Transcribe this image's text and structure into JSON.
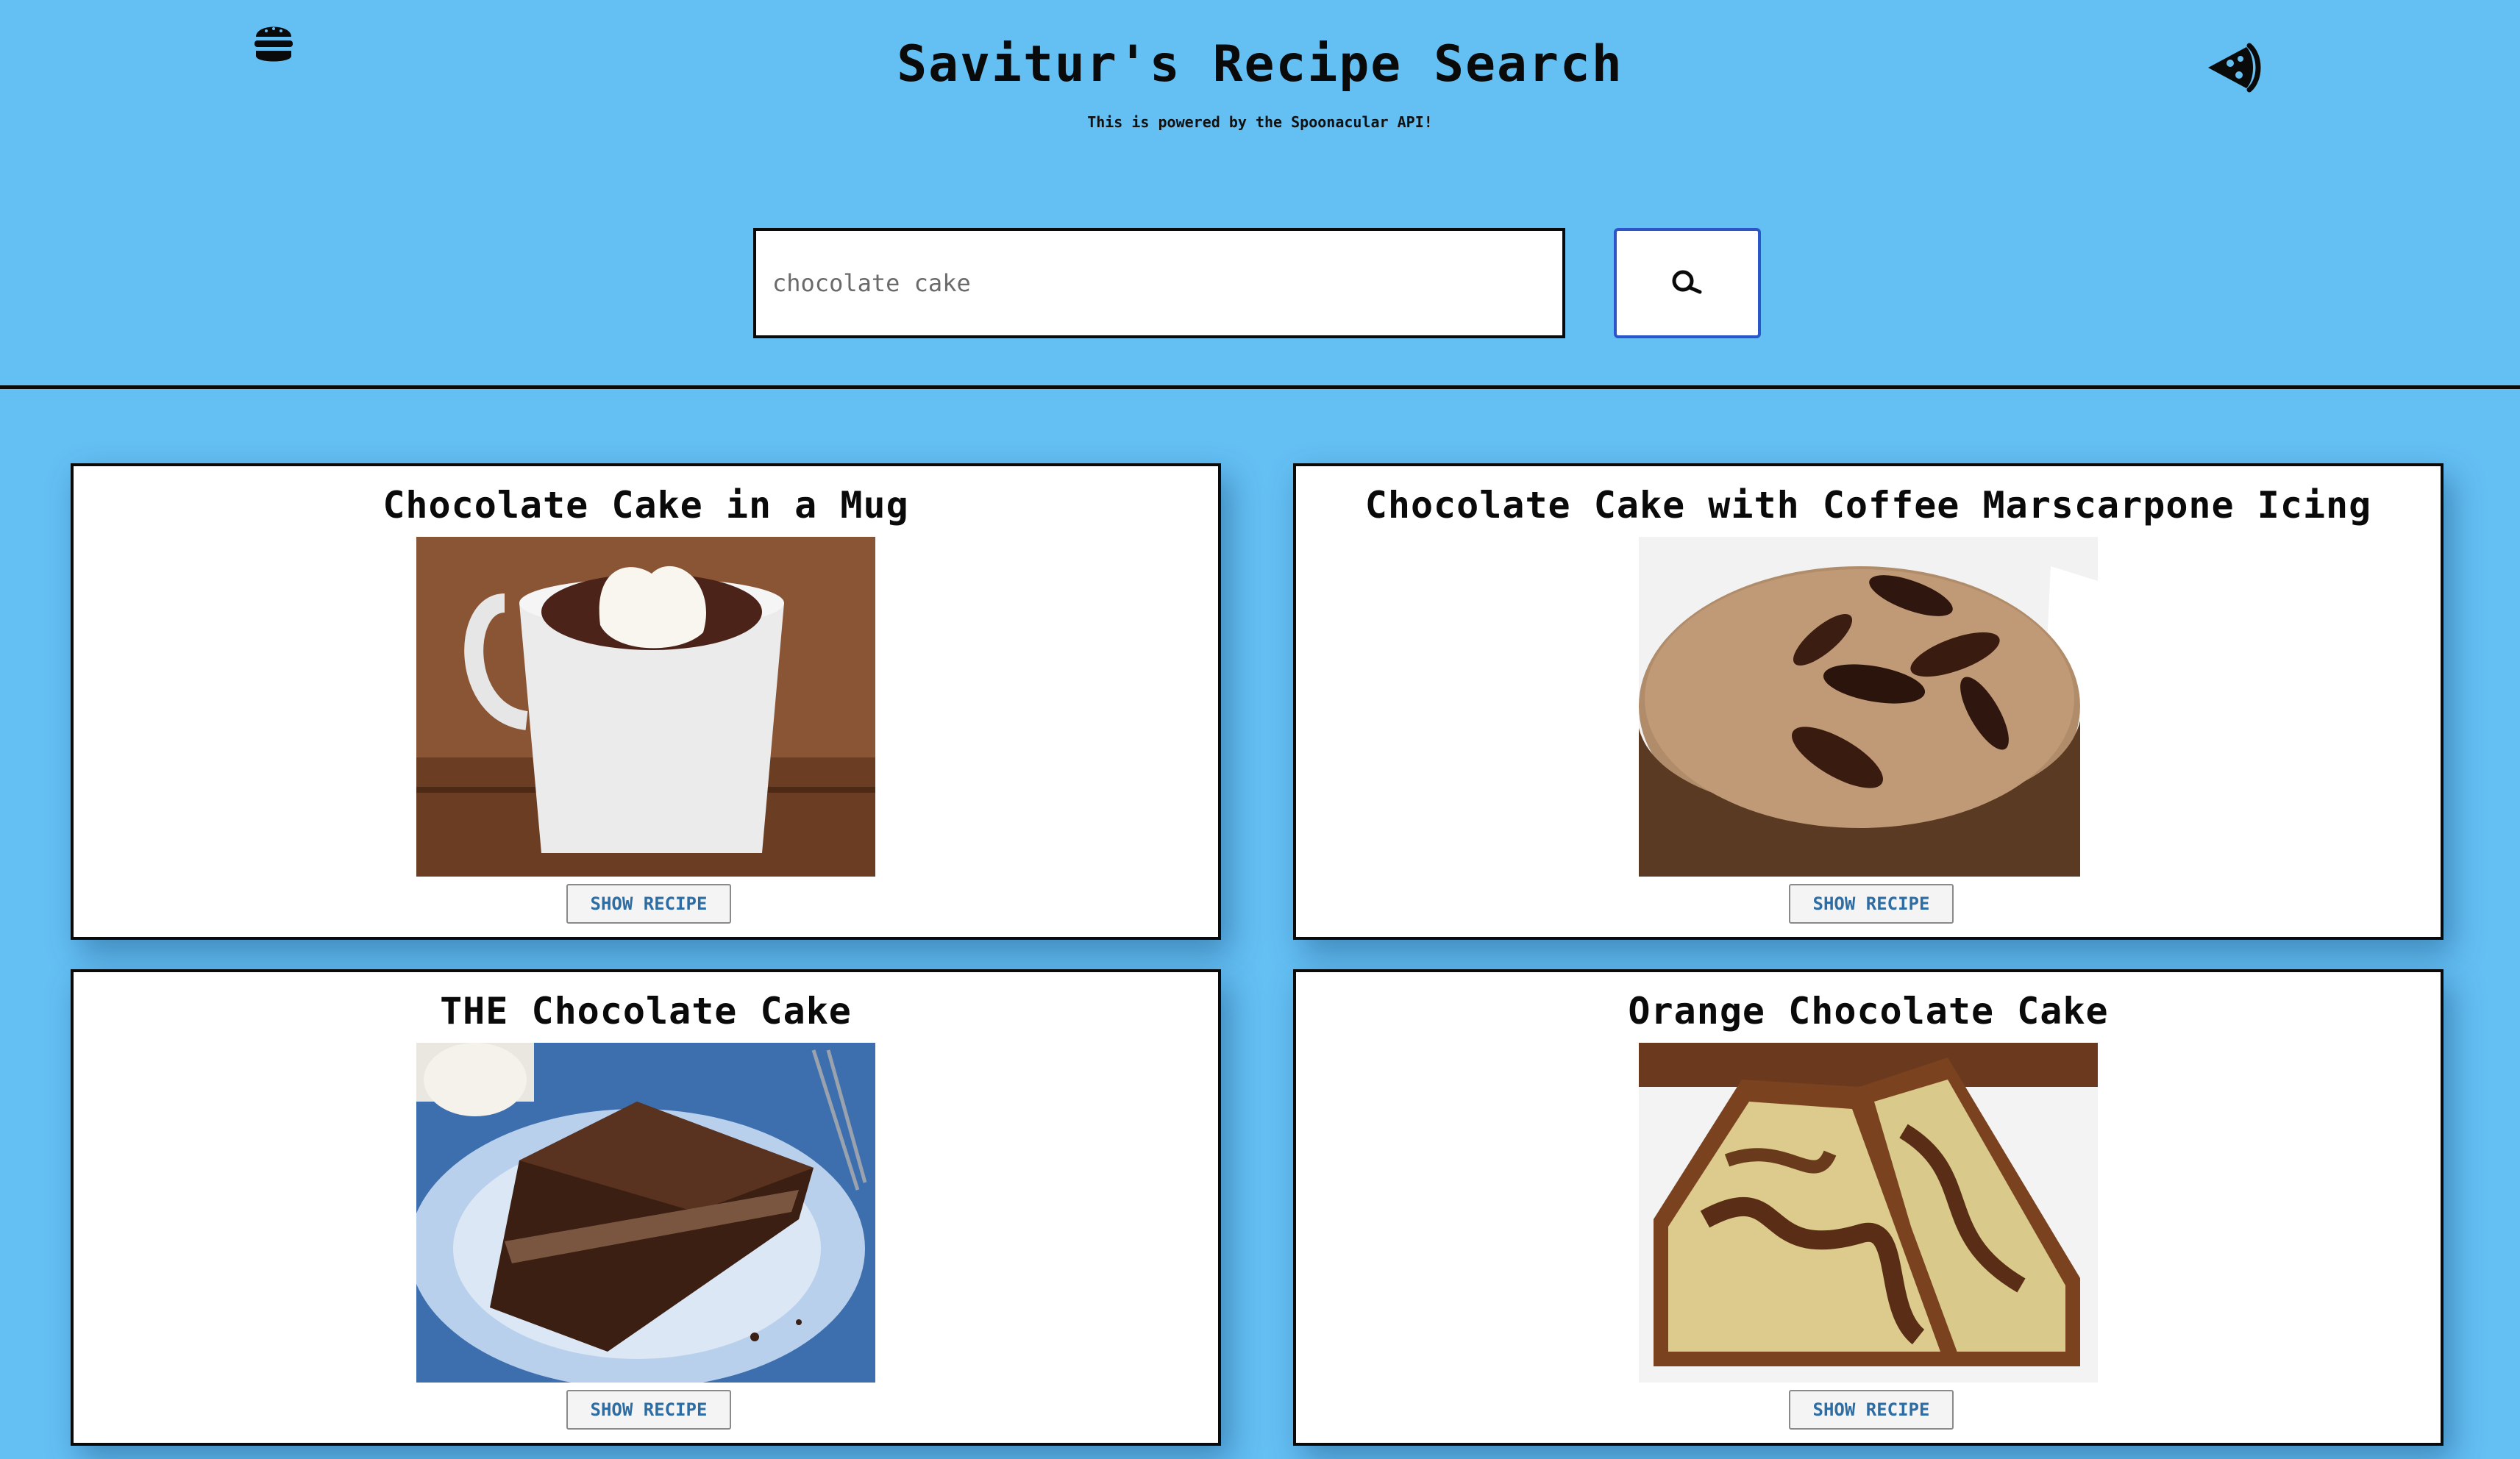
{
  "header": {
    "title": "Savitur's Recipe Search",
    "subtitle": "This is powered by the Spoonacular API!",
    "left_icon": "burger-icon",
    "right_icon": "pizza-icon"
  },
  "search": {
    "placeholder": "chocolate cake",
    "value": "",
    "button_icon": "search-icon"
  },
  "colors": {
    "background": "#64bff3",
    "card_background": "#ffffff",
    "border": "#0a0a0a",
    "button_text": "#2d6da3",
    "search_button_border": "#2a56c9"
  },
  "results": [
    {
      "title": "Chocolate Cake in a Mug",
      "button_label": "SHOW RECIPE",
      "image": "mug-cake-photo"
    },
    {
      "title": "Chocolate Cake with Coffee Marscarpone Icing",
      "button_label": "SHOW RECIPE",
      "image": "coffee-icing-cake-photo"
    },
    {
      "title": "THE Chocolate Cake",
      "button_label": "SHOW RECIPE",
      "image": "chocolate-layer-cake-photo"
    },
    {
      "title": "Orange Chocolate Cake",
      "button_label": "SHOW RECIPE",
      "image": "marble-bundt-cake-photo"
    }
  ]
}
